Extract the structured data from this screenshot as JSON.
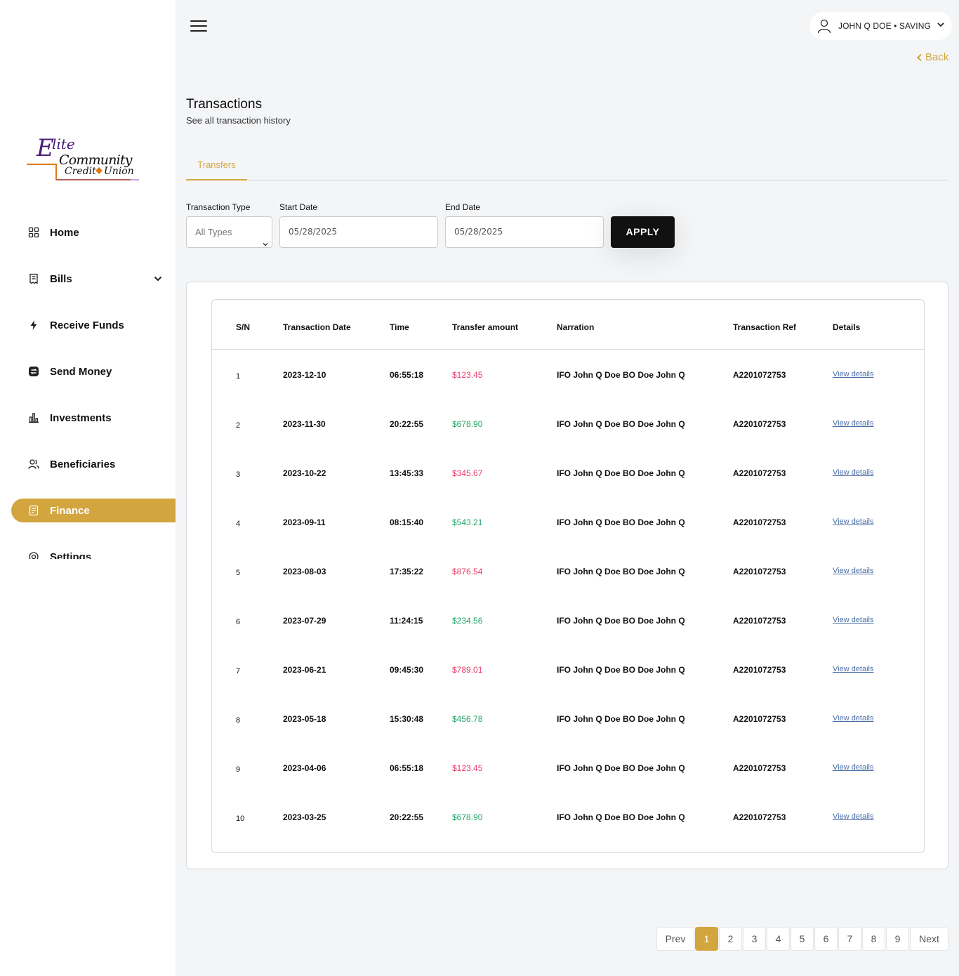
{
  "brand": {
    "logo_line1": "Elite",
    "logo_line2": "Community",
    "logo_line3": "Credit",
    "logo_line4": "Union",
    "accent_color": "#d3a53f",
    "logo_purple": "#4b1d7a",
    "logo_orange": "#e07b1a"
  },
  "sidebar": {
    "items": [
      {
        "label": "Home",
        "icon": "home-grid-icon"
      },
      {
        "label": "Bills",
        "icon": "receipt-icon",
        "has_chevron": true
      },
      {
        "label": "Receive Funds",
        "icon": "lightning-icon"
      },
      {
        "label": "Send Money",
        "icon": "transfer-icon"
      },
      {
        "label": "Investments",
        "icon": "bar-chart-icon"
      },
      {
        "label": "Beneficiaries",
        "icon": "users-icon"
      },
      {
        "label": "Finance",
        "icon": "document-icon",
        "active": true
      },
      {
        "label": "Settings",
        "icon": "settings-icon"
      }
    ]
  },
  "header": {
    "account_label": "JOHN Q DOE • SAVING",
    "back_label": "Back"
  },
  "page": {
    "title": "Transactions",
    "subtitle": "See all transaction history"
  },
  "tabs": [
    {
      "label": "Transfers",
      "active": true
    }
  ],
  "filters": {
    "type_label": "Transaction Type",
    "type_value": "All Types",
    "start_label": "Start Date",
    "start_value": "05/28/2025",
    "end_label": "End Date",
    "end_value": "05/28/2025",
    "apply_label": "APPLY"
  },
  "table": {
    "columns": [
      "S/N",
      "Transaction Date",
      "Time",
      "Transfer amount",
      "Narration",
      "Transaction Ref",
      "Details"
    ],
    "rows": [
      {
        "sn": "1",
        "date": "2023-12-10",
        "time": "06:55:18",
        "amount": "$123.45",
        "kind": "debit",
        "narration": "IFO John Q Doe BO Doe John Q",
        "ref": "A2201072753",
        "details": "View details"
      },
      {
        "sn": "2",
        "date": "2023-11-30",
        "time": "20:22:55",
        "amount": "$678.90",
        "kind": "credit",
        "narration": "IFO John Q Doe BO Doe John Q",
        "ref": "A2201072753",
        "details": "View details"
      },
      {
        "sn": "3",
        "date": "2023-10-22",
        "time": "13:45:33",
        "amount": "$345.67",
        "kind": "debit",
        "narration": "IFO John Q Doe BO Doe John Q",
        "ref": "A2201072753",
        "details": "View details"
      },
      {
        "sn": "4",
        "date": "2023-09-11",
        "time": "08:15:40",
        "amount": "$543.21",
        "kind": "credit",
        "narration": "IFO John Q Doe BO Doe John Q",
        "ref": "A2201072753",
        "details": "View details"
      },
      {
        "sn": "5",
        "date": "2023-08-03",
        "time": "17:35:22",
        "amount": "$876.54",
        "kind": "debit",
        "narration": "IFO John Q Doe BO Doe John Q",
        "ref": "A2201072753",
        "details": "View details"
      },
      {
        "sn": "6",
        "date": "2023-07-29",
        "time": "11:24:15",
        "amount": "$234.56",
        "kind": "credit",
        "narration": "IFO John Q Doe BO Doe John Q",
        "ref": "A2201072753",
        "details": "View details"
      },
      {
        "sn": "7",
        "date": "2023-06-21",
        "time": "09:45:30",
        "amount": "$789.01",
        "kind": "debit",
        "narration": "IFO John Q Doe BO Doe John Q",
        "ref": "A2201072753",
        "details": "View details"
      },
      {
        "sn": "8",
        "date": "2023-05-18",
        "time": "15:30:48",
        "amount": "$456.78",
        "kind": "credit",
        "narration": "IFO John Q Doe BO Doe John Q",
        "ref": "A2201072753",
        "details": "View details"
      },
      {
        "sn": "9",
        "date": "2023-04-06",
        "time": "06:55:18",
        "amount": "$123.45",
        "kind": "debit",
        "narration": "IFO John Q Doe BO Doe John Q",
        "ref": "A2201072753",
        "details": "View details"
      },
      {
        "sn": "10",
        "date": "2023-03-25",
        "time": "20:22:55",
        "amount": "$678.90",
        "kind": "credit",
        "narration": "IFO John Q Doe BO Doe John Q",
        "ref": "A2201072753",
        "details": "View details"
      }
    ],
    "debit_color": "#e83d6a",
    "credit_color": "#22a56a"
  },
  "pagination": {
    "prev_label": "Prev",
    "next_label": "Next",
    "pages": [
      "1",
      "2",
      "3",
      "4",
      "5",
      "6",
      "7",
      "8",
      "9"
    ],
    "current": "1"
  }
}
